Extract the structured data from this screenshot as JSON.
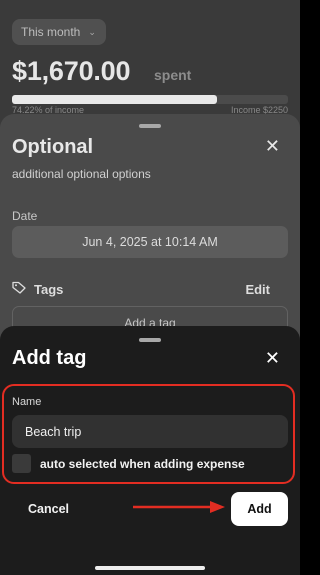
{
  "header": {
    "month_selector": "This month",
    "amount": "$1,670.00",
    "amount_suffix": "spent",
    "progress_fraction": 0.7422,
    "percent_of_income": "74.22% of income",
    "income": "Income $2250"
  },
  "optional_sheet": {
    "title": "Optional",
    "close_icon": "close-icon",
    "subtitle": "additional optional options",
    "date_label": "Date",
    "date_value": "Jun 4, 2025 at 10:14 AM",
    "tags_icon": "tag-icon",
    "tags_label": "Tags",
    "edit_label": "Edit",
    "add_tag_label": "Add a tag"
  },
  "add_tag_sheet": {
    "title": "Add tag",
    "close_icon": "close-icon",
    "name_label": "Name",
    "name_value": "Beach trip",
    "name_placeholder": "",
    "auto_select_label": "auto selected when adding expense",
    "auto_select_checked": false,
    "cancel_label": "Cancel",
    "add_label": "Add"
  },
  "colors": {
    "annotation": "#e32d22",
    "sheet_bg": "#1c1c1c"
  }
}
